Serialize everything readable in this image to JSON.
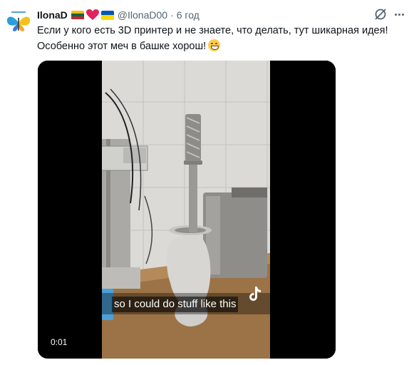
{
  "tweet": {
    "author_name": "IlonaD",
    "flags": [
      "lithuania-flag",
      "red-heart",
      "ukraine-flag"
    ],
    "handle": "@IlonaD00",
    "separator": "·",
    "time": "6 год",
    "text_line1": "Если у кого есть 3D принтер и не знаете, что делать, тут шикарная идея!",
    "text_line2": "Особенно этот меч в башке хорош!",
    "emoji": "grinning-face"
  },
  "video": {
    "caption": "so I could do stuff like this",
    "timestamp": "0:01",
    "watermark": "tiktok-logo"
  },
  "colors": {
    "text": "#0f1419",
    "secondary": "#536471",
    "flag_lt": [
      "#fdb913",
      "#006a44",
      "#c1272d"
    ],
    "flag_ua": [
      "#0057b7",
      "#ffd700"
    ],
    "heart": "#e0245e"
  }
}
